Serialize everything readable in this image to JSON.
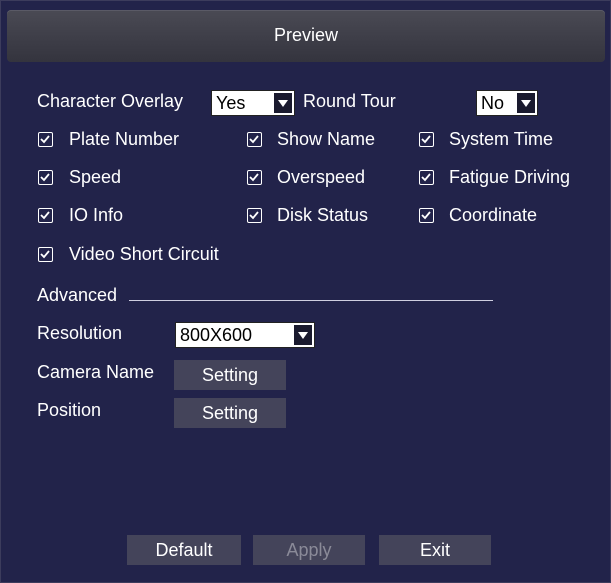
{
  "window": {
    "title": "Preview"
  },
  "overlay": {
    "character_overlay_label": "Character Overlay",
    "character_overlay_value": "Yes",
    "round_tour_label": "Round Tour",
    "round_tour_value": "No"
  },
  "checkboxes": [
    {
      "label": "Plate Number",
      "checked": true
    },
    {
      "label": "Show Name",
      "checked": true
    },
    {
      "label": "System Time",
      "checked": true
    },
    {
      "label": "Speed",
      "checked": true
    },
    {
      "label": "Overspeed",
      "checked": true
    },
    {
      "label": "Fatigue Driving",
      "checked": true
    },
    {
      "label": "IO Info",
      "checked": true
    },
    {
      "label": "Disk Status",
      "checked": true
    },
    {
      "label": "Coordinate",
      "checked": true
    },
    {
      "label": "Video Short Circuit",
      "checked": true
    }
  ],
  "advanced": {
    "section_label": "Advanced",
    "resolution_label": "Resolution",
    "resolution_value": "800X600",
    "camera_name_label": "Camera Name",
    "camera_name_button": "Setting",
    "position_label": "Position",
    "position_button": "Setting"
  },
  "footer": {
    "default_label": "Default",
    "apply_label": "Apply",
    "exit_label": "Exit"
  }
}
